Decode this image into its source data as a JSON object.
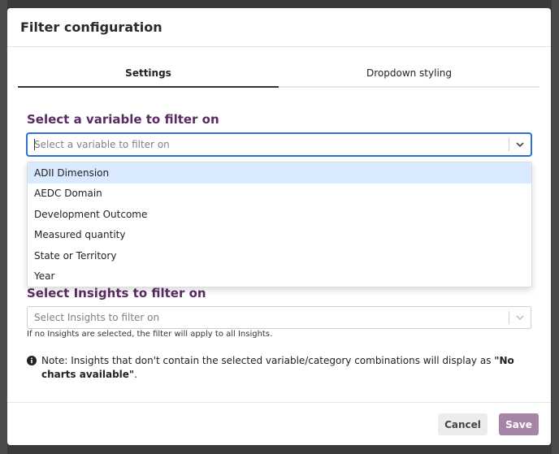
{
  "modal": {
    "title": "Filter configuration"
  },
  "tabs": [
    {
      "label": "Settings",
      "active": true
    },
    {
      "label": "Dropdown styling",
      "active": false
    }
  ],
  "variable_section": {
    "heading": "Select a variable to filter on",
    "placeholder": "Select a variable to filter on",
    "options": [
      "ADII Dimension",
      "AEDC Domain",
      "Development Outcome",
      "Measured quantity",
      "State or Territory",
      "Year"
    ],
    "highlighted_option": "ADII Dimension"
  },
  "insights_section": {
    "heading": "Select Insights to filter on",
    "placeholder": "Select Insights to filter on",
    "helper": "If no Insights are selected, the filter will apply to all Insights."
  },
  "note": {
    "prefix": "Note: Insights that don't contain the selected variable/category combinations will display as ",
    "emphasis": "\"No charts available\"",
    "suffix": "."
  },
  "footer": {
    "cancel_label": "Cancel",
    "save_label": "Save"
  },
  "colors": {
    "heading": "#5a2a63",
    "save_button": "#a684a8",
    "focus_border": "#2d6fd6",
    "highlight": "#d9e9ff"
  },
  "icons": {
    "dropdown": "chevron-down-icon",
    "note": "info-icon"
  }
}
